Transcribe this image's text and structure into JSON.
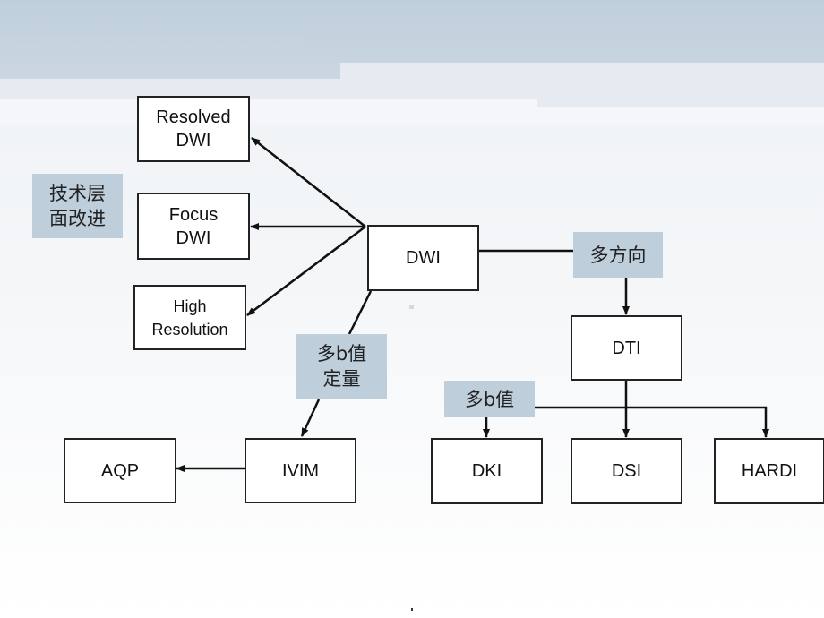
{
  "nodes": {
    "resolved_dwi": "Resolved\nDWI",
    "focus_dwi": "Focus\nDWI",
    "high_resolution": "High\nResolution",
    "dwi": "DWI",
    "dti": "DTI",
    "aqp": "AQP",
    "ivim": "IVIM",
    "dki": "DKI",
    "dsi": "DSI",
    "hardi": "HARDI"
  },
  "labels": {
    "technical_improvement": "技术层\n面改进",
    "multi_direction": "多方向",
    "multi_b_quant": "多b值\n定量",
    "multi_b": "多b值"
  },
  "colors": {
    "label_bg": "#bfcedb",
    "line": "#111111"
  }
}
